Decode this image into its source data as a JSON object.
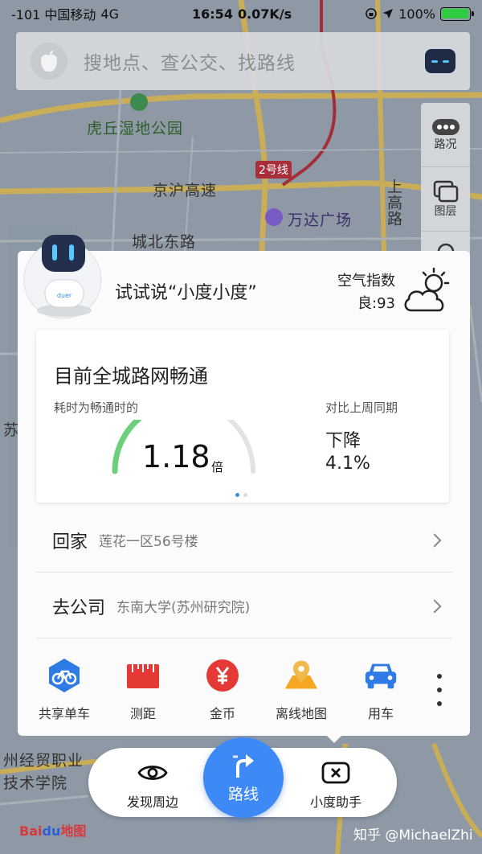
{
  "status_bar": {
    "carrier": "-101 中国移动",
    "network": "4G",
    "time": "16:54",
    "speed": "0.07K/s",
    "battery_percent": "100%",
    "battery_level": 1.0
  },
  "search": {
    "placeholder": "搜地点、查公交、找路线",
    "left_icon": "apple-logo-icon",
    "right_icon": "robot-assistant-icon"
  },
  "map": {
    "labels": {
      "park": "虎丘湿地公园",
      "expressway": "京沪高速",
      "metro_line": "2号线",
      "wanda": "万达广场",
      "road_north": "城北东路",
      "gaosu_vertical": "上高路",
      "su_fragment": "苏",
      "school": "州经贸职业\n技术学院"
    }
  },
  "right_tools": {
    "traffic_label": "路况",
    "layers_label": "图层"
  },
  "assistant": {
    "prompt": "试试说“小度小度”",
    "avatar_text": "duer"
  },
  "air": {
    "title": "空气指数",
    "value": "良:93",
    "weather_icon": "partly-cloudy-icon"
  },
  "traffic": {
    "title": "目前全城路网畅通",
    "subtitle": "耗时为畅通时的",
    "ratio": "1.18",
    "unit": "倍",
    "gauge_fraction": 0.3,
    "compare_label": "对比上周同期",
    "trend": "下降",
    "percent": "4.1%",
    "page_index": 1,
    "page_count": 2
  },
  "favorites": [
    {
      "name": "回家",
      "address": "莲花一区56号楼"
    },
    {
      "name": "去公司",
      "address": "东南大学(苏州研究院)"
    }
  ],
  "tools": [
    {
      "label": "共享单车",
      "icon": "bike-icon",
      "color": "#2e7be6"
    },
    {
      "label": "测距",
      "icon": "ruler-icon",
      "color": "#e53935"
    },
    {
      "label": "金币",
      "icon": "yen-coin-icon",
      "color": "#e53935"
    },
    {
      "label": "离线地图",
      "icon": "offline-map-icon",
      "color": "#f5a623"
    },
    {
      "label": "用车",
      "icon": "car-icon",
      "color": "#2e7be6"
    }
  ],
  "bottom_bar": {
    "discover": "发现周边",
    "route": "路线",
    "assistant": "小度助手"
  },
  "brand": {
    "logo_text_bai": "Bai",
    "logo_text_du": "du",
    "logo_text_map": "地图",
    "watermark": "知乎 @MichaelZhi"
  },
  "colors": {
    "accent": "#3d8af7",
    "gauge_green": "#6cd07a",
    "metro_red": "#a82f3a"
  }
}
